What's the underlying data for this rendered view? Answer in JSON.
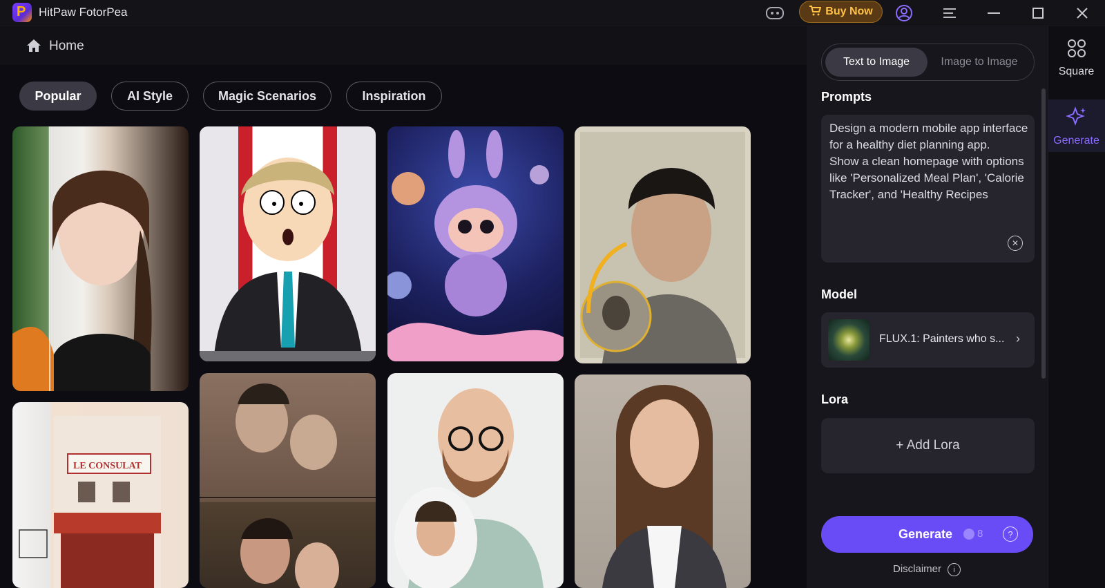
{
  "app": {
    "title": "HitPaw FotorPea"
  },
  "titlebar": {
    "buy_label": "Buy Now",
    "icons": [
      "discord-icon",
      "cart-icon",
      "account-icon",
      "menu-icon",
      "minimize-icon",
      "maximize-icon",
      "close-icon"
    ]
  },
  "nav": {
    "home_label": "Home"
  },
  "categories": [
    {
      "label": "Popular",
      "active": true
    },
    {
      "label": "AI Style",
      "active": false
    },
    {
      "label": "Magic Scenarios",
      "active": false
    },
    {
      "label": "Inspiration",
      "active": false
    }
  ],
  "gallery": [
    "portrait-woman-braid",
    "cartoon-politician",
    "purple-creature-space",
    "restored-old-photo-man",
    "sketch-to-color-cafe",
    "restored-vintage-couple",
    "man-with-glasses",
    "professional-woman"
  ],
  "panel": {
    "modes": [
      {
        "label": "Text to Image",
        "active": true
      },
      {
        "label": "Image to Image",
        "active": false
      }
    ],
    "prompts_title": "Prompts",
    "prompt_text": "Design a modern mobile app interface for a healthy diet planning app.\nShow a clean homepage with options like 'Personalized Meal Plan', 'Calorie Tracker', and 'Healthy Recipes",
    "model_title": "Model",
    "model_name": "FLUX.1: Painters who s...",
    "lora_title": "Lora",
    "add_lora_label": "+ Add Lora",
    "generate_label": "Generate",
    "generate_cost": "8",
    "disclaimer_label": "Disclaimer"
  },
  "rail": {
    "items": [
      {
        "label": "Square",
        "active": false
      },
      {
        "label": "Generate",
        "active": true
      }
    ]
  },
  "colors": {
    "accent": "#6a4cf7",
    "buy": "#ffc24a"
  }
}
